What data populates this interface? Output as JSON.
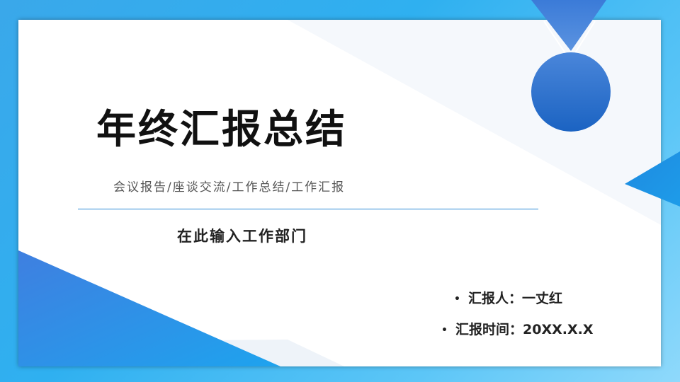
{
  "slide": {
    "title": "年终汇报总结",
    "subtitle": "会议报告/座谈交流/工作总结/工作汇报",
    "department": "在此输入工作部门",
    "reporter": "汇报人：一丈红",
    "time": "汇报时间：20XX.X.X",
    "bullet": "•"
  },
  "colors": {
    "accent_blue": "#2c7fd6",
    "sky_blue": "#2fb0f0",
    "card": "#ffffff"
  },
  "decor": {
    "medal": "medal-shape",
    "corner_triangles": "triangle-shapes"
  }
}
